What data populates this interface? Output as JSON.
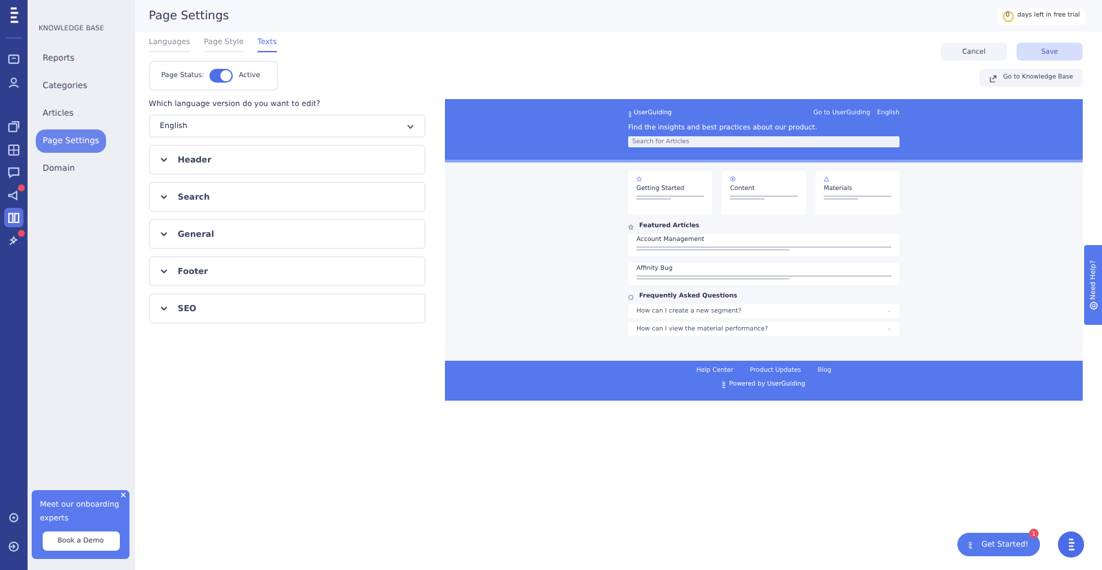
{
  "rail": {
    "items": [
      {
        "selected": false,
        "alert": false
      },
      {
        "selected": false,
        "alert": false
      },
      {
        "selected": false,
        "alert": false
      },
      {
        "selected": false,
        "alert": false
      },
      {
        "selected": false,
        "alert": false
      },
      {
        "selected": false,
        "alert": true
      },
      {
        "selected": true,
        "alert": false
      },
      {
        "selected": false,
        "alert": true
      }
    ]
  },
  "sidebar": {
    "section": "KNOWLEDGE BASE",
    "items": [
      {
        "label": "Reports",
        "selected": false
      },
      {
        "label": "Categories",
        "selected": false
      },
      {
        "label": "Articles",
        "selected": false
      },
      {
        "label": "Page Settings",
        "selected": true
      },
      {
        "label": "Domain",
        "selected": false
      }
    ]
  },
  "header": {
    "title": "Page Settings",
    "trial": {
      "count": "0",
      "text": "days left in free trial"
    }
  },
  "tabs": [
    {
      "label": "Languages",
      "selected": false
    },
    {
      "label": "Page Style",
      "selected": false
    },
    {
      "label": "Texts",
      "selected": true
    }
  ],
  "actions": {
    "cancel": "Cancel",
    "save": {
      "label": "Save",
      "disabled": true
    },
    "go_to": "Go to Knowledge Base"
  },
  "page_status": {
    "label": "Page Status:",
    "on": true,
    "state": "Active"
  },
  "language": {
    "question": "Which language version do you want to edit?",
    "value": "English"
  },
  "sections": [
    {
      "label": "Header",
      "expanded": false
    },
    {
      "label": "Search",
      "expanded": false
    },
    {
      "label": "General",
      "expanded": false
    },
    {
      "label": "Footer",
      "expanded": false
    },
    {
      "label": "SEO",
      "expanded": false
    }
  ],
  "preview": {
    "brand": "UserGuiding",
    "go_to": "Go to UserGuiding",
    "language": "English",
    "headline": "Find the insights and best practices about our product.",
    "search_placeholder": "Search for Articles",
    "cards": [
      {
        "title": "Getting Started"
      },
      {
        "title": "Content"
      },
      {
        "title": "Materials"
      }
    ],
    "featured_title": "Featured Articles",
    "articles": [
      {
        "title": "Account Management"
      },
      {
        "title": "Affinity Bug"
      }
    ],
    "faq_title": "Frequently Asked Questions",
    "faqs": [
      "How can I create a new segment?",
      "How can I view the material performance?"
    ],
    "footer_links": [
      "Help Center",
      "Product Updates",
      "Blog"
    ],
    "powered": "Powered by UserGuiding"
  },
  "onboarding": {
    "text": "Meet our onboarding experts",
    "button": "Book a Demo"
  },
  "help_tab": "Need Help?",
  "get_started": {
    "label": "Get Started!",
    "badge": "1"
  }
}
